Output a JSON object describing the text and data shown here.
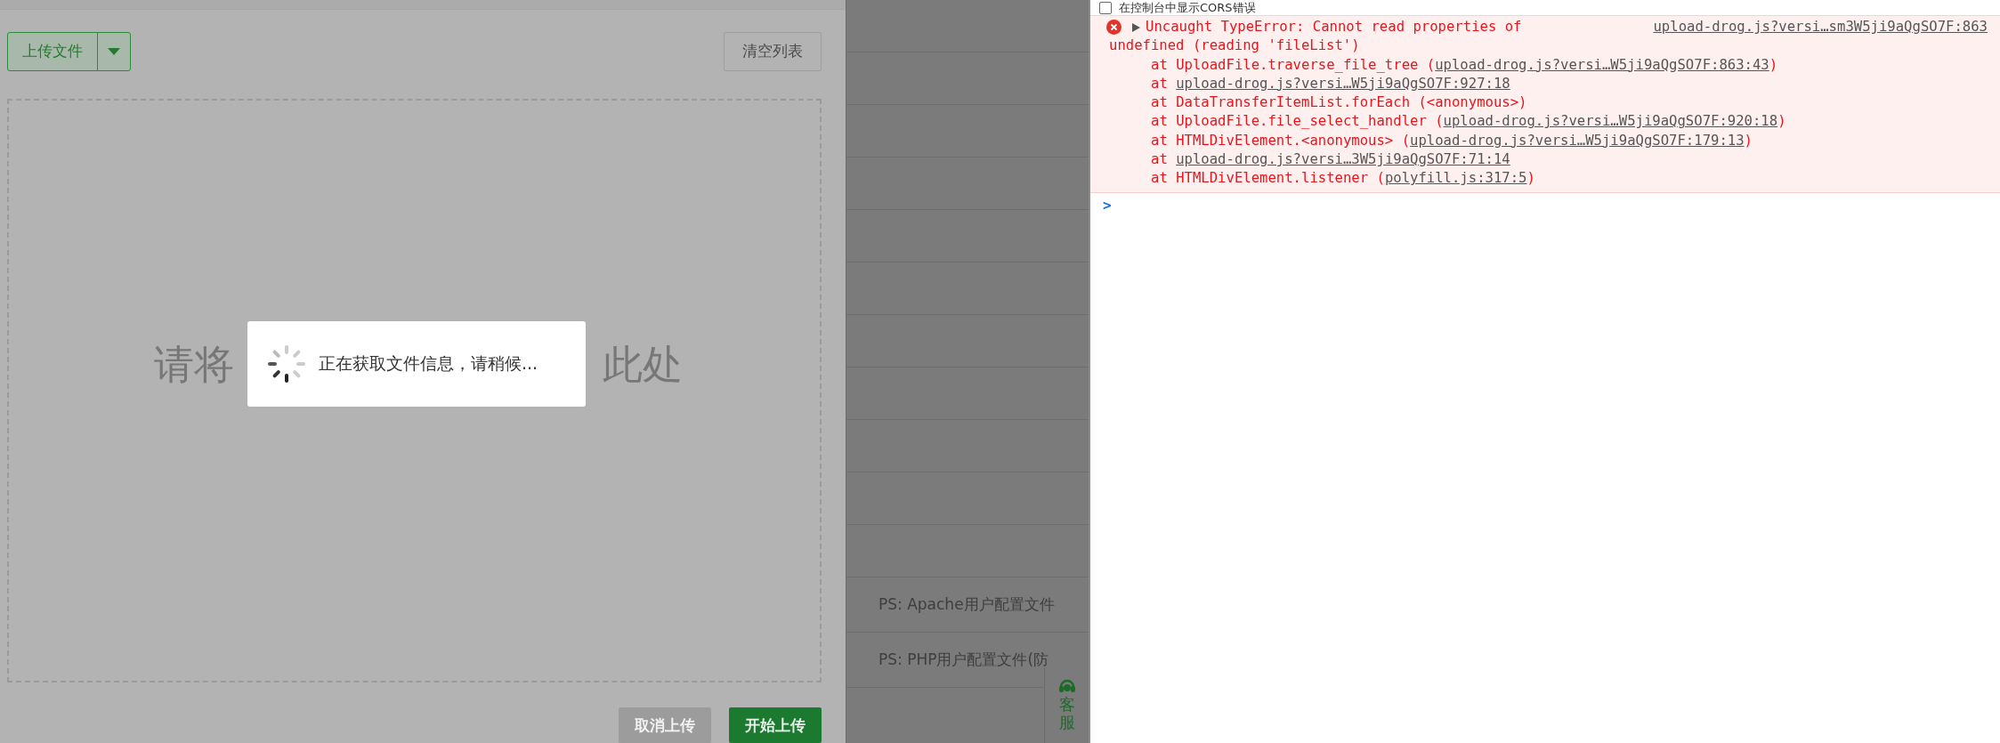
{
  "upload_panel": {
    "upload_button": "上传文件",
    "clear_button": "清空列表",
    "drop_hint_left": "请将",
    "drop_hint_right": "此处",
    "cancel_button": "取消上传",
    "start_button": "开始上传"
  },
  "loading_dialog": {
    "message": "正在获取文件信息，请稍候..."
  },
  "background_list": {
    "rows": [
      "PS: Apache用户配置文件",
      "PS: PHP用户配置文件(防"
    ],
    "support_button": "客服"
  },
  "console": {
    "option": {
      "label": "在控制台中显示CORS错误",
      "checked": false
    },
    "error": {
      "expanded": false,
      "message_lines": [
        "Uncaught TypeError: Cannot read properties of",
        "undefined (reading 'fileList')"
      ],
      "source_link": "upload-drog.js?versi…sm3W5ji9aQgSO7F:863",
      "stack": [
        {
          "text": "at UploadFile.traverse_file_tree (",
          "link": "upload-drog.js?versi…W5ji9aQgSO7F:863:43",
          "after": ")"
        },
        {
          "text": "at ",
          "link": "upload-drog.js?versi…W5ji9aQgSO7F:927:18"
        },
        {
          "text": "at DataTransferItemList.forEach (<anonymous>)"
        },
        {
          "text": "at UploadFile.file_select_handler (",
          "link": "upload-drog.js?versi…W5ji9aQgSO7F:920:18",
          "after": ")"
        },
        {
          "text": "at HTMLDivElement.<anonymous> (",
          "link": "upload-drog.js?versi…W5ji9aQgSO7F:179:13",
          "after": ")"
        },
        {
          "text": "at ",
          "link": "upload-drog.js?versi…3W5ji9aQgSO7F:71:14"
        },
        {
          "text": "at HTMLDivElement.listener (",
          "link": "polyfill.js:317:5",
          "after": ")"
        }
      ]
    },
    "prompt": ">"
  }
}
